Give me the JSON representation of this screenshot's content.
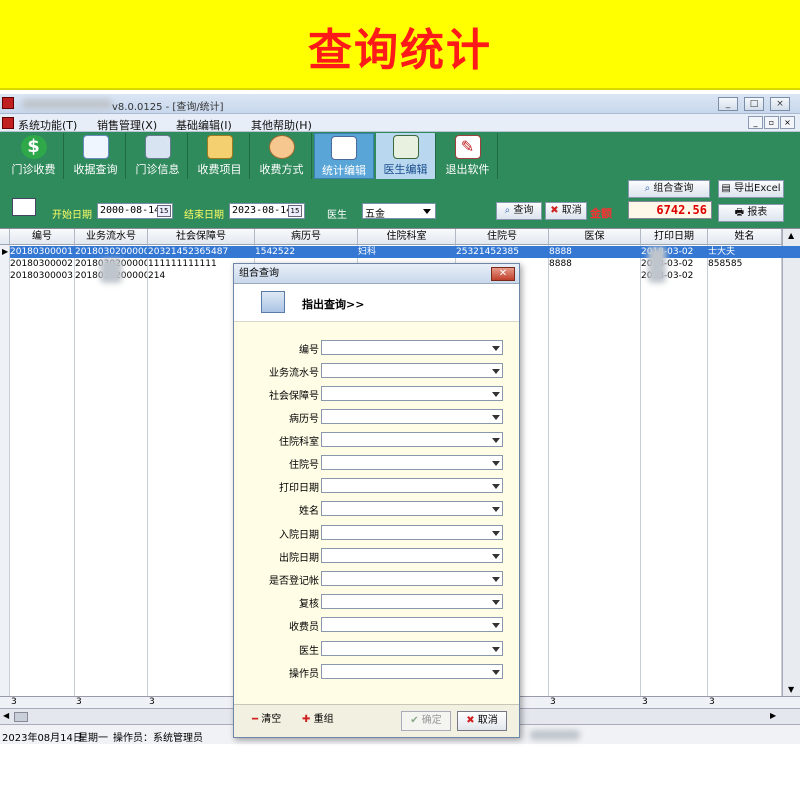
{
  "banner": {
    "title": "查询统计"
  },
  "window": {
    "title": "v8.0.0125 - [查询/统计]",
    "controls": [
      "_",
      "□",
      "×"
    ]
  },
  "menu": [
    {
      "label": "系统功能(T)"
    },
    {
      "label": "销售管理(X)"
    },
    {
      "label": "基础编辑(I)"
    },
    {
      "label": "其他帮助(H)"
    }
  ],
  "toolbar": [
    {
      "label": "门诊收费",
      "icon": "dollar-icon"
    },
    {
      "label": "收据查询",
      "icon": "search-doc-icon"
    },
    {
      "label": "门诊信息",
      "icon": "building-icon"
    },
    {
      "label": "收费项目",
      "icon": "people-icon"
    },
    {
      "label": "收费方式",
      "icon": "person-icon"
    },
    {
      "label": "统计编辑",
      "icon": "chart-icon"
    },
    {
      "label": "医生编辑",
      "icon": "id-card-icon"
    },
    {
      "label": "退出软件",
      "icon": "exit-icon"
    }
  ],
  "filter": {
    "start_label": "开始日期",
    "start_date": "2000-08-14",
    "end_label": "结束日期",
    "end_date": "2023-08-14",
    "doctor_label": "医生",
    "doctor_value": "五金",
    "query_btn": "查询",
    "cancel_btn": "取消",
    "amount_label": "金额",
    "combo_query_btn": "组合查询",
    "export_btn": "导出Excel",
    "report_btn": "报表",
    "total": "6742.56"
  },
  "grid": {
    "headers": [
      "编号",
      "业务流水号",
      "社会保障号",
      "病历号",
      "住院科室",
      "住院号",
      "医保",
      "打印日期",
      "姓名"
    ],
    "rows": [
      [
        "20180300001",
        "20180302000001",
        "20321452365487",
        "1542522",
        "妇科",
        "25321452385",
        "8888",
        "2018-03-02",
        "士大夫"
      ],
      [
        "20180300002",
        "20180302000002",
        "111111111111",
        "",
        "",
        "",
        "8888",
        "2018-03-02",
        "858585"
      ],
      [
        "20180300003",
        "20180302000003",
        "214",
        "",
        "",
        "",
        "",
        "2018-03-02",
        ""
      ]
    ],
    "footer": [
      "3",
      "3",
      "3",
      "3",
      "3",
      "3",
      "3",
      "3",
      "3"
    ]
  },
  "status": {
    "date": "2023年08月14日",
    "weekday": "星期一",
    "operator": "操作员：系统管理员"
  },
  "dialog": {
    "title": "组合查询",
    "heading": "指出查询>>",
    "fields": [
      "编号",
      "业务流水号",
      "社会保障号",
      "病历号",
      "住院科室",
      "住院号",
      "打印日期",
      "姓名",
      "入院日期",
      "出院日期",
      "是否登记帐",
      "复核",
      "收费员",
      "医生",
      "操作员"
    ],
    "clear_btn": "清空",
    "regroup_btn": "重组",
    "ok_btn": "确定",
    "cancel_btn": "取消"
  }
}
